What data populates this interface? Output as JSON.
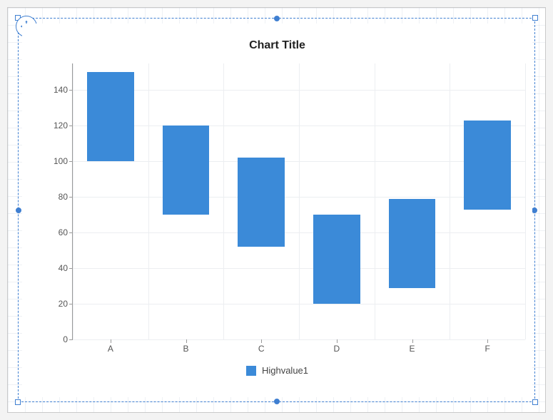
{
  "title": "Chart Title",
  "legend": {
    "label": "Highvalue1",
    "color": "#3b8ad8"
  },
  "chart_data": {
    "type": "bar",
    "variant": "range",
    "title": "Chart Title",
    "xlabel": "",
    "ylabel": "",
    "ylim": [
      0,
      155
    ],
    "y_ticks": [
      0,
      20,
      40,
      60,
      80,
      100,
      120,
      140
    ],
    "categories": [
      "A",
      "B",
      "C",
      "D",
      "E",
      "F"
    ],
    "series": [
      {
        "name": "Highvalue1",
        "color": "#3b8ad8",
        "ranges": [
          {
            "category": "A",
            "low": 100,
            "high": 150
          },
          {
            "category": "B",
            "low": 70,
            "high": 120
          },
          {
            "category": "C",
            "low": 52,
            "high": 102
          },
          {
            "category": "D",
            "low": 20,
            "high": 70
          },
          {
            "category": "E",
            "low": 29,
            "high": 79
          },
          {
            "category": "F",
            "low": 73,
            "high": 123
          }
        ]
      }
    ],
    "legend_position": "bottom",
    "grid": true
  }
}
